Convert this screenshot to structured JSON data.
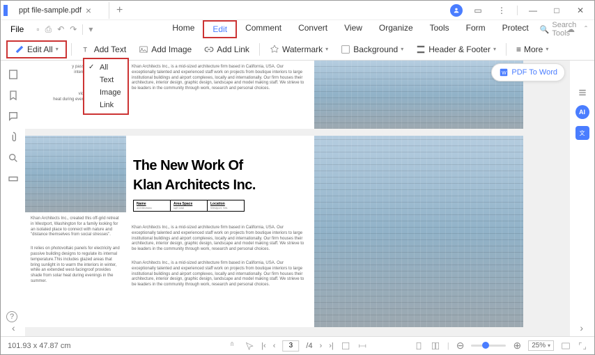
{
  "tab": {
    "title": "ppt file-sample.pdf"
  },
  "menu": {
    "file": "File",
    "tabs": [
      "Home",
      "Edit",
      "Comment",
      "Convert",
      "View",
      "Organize",
      "Tools",
      "Form",
      "Protect"
    ],
    "active": "Edit",
    "search": "Search Tools"
  },
  "toolbar": {
    "edit_all": "Edit All",
    "add_text": "Add Text",
    "add_image": "Add Image",
    "add_link": "Add Link",
    "watermark": "Watermark",
    "background": "Background",
    "header_footer": "Header & Footer",
    "more": "More"
  },
  "dropdown": {
    "items": [
      "All",
      "Text",
      "Image",
      "Link"
    ],
    "checked": "All"
  },
  "float_btn": "PDF To Word",
  "page": {
    "heading1": "The New Work Of",
    "heading2": "Klan Architects Inc.",
    "table": [
      {
        "lbl": "Name",
        "val": "architectsinc"
      },
      {
        "lbl": "Area Space",
        "val": "sqft total"
      },
      {
        "lbl": "Location",
        "val": "Westport, WA"
      }
    ],
    "left_txt_top": "y passive building designs\ninternal temperature.This\nd areas that bring\nvarm the interiors in\nin extended west-\nvides shade from solar\nheat during evenings in the summer.",
    "body1": "Khan Architects Inc., is a mid-sized architecture firm based in California, USA. Our exceptionally talented and experienced staff work on projects from boutique interiors to large institutional buildings and airport complexes, locally and internationally. Our firm houses their architecture, interior design, graphic design, landscape and model making staff. We strieve to be leaders in the community through work, research and personal choices.",
    "left_txt2a": "Khan Architects Inc., created this off-grid retreat in Westport, Washington for a family looking for an isolated place to connect with nature and \"distance themselves from social stresses\".",
    "left_txt2b": "It relies on photovoltaic panels for electricity and passive building designs to regulate its internal temperature.This includes glazed areas that bring sunlight in to warm the interiors in winter, while an extended west-facingroof provides shade from solar heat during evenings in the summer."
  },
  "status": {
    "dims": "101.93 x 47.87 cm",
    "page_current": "3",
    "page_total": "/4",
    "zoom": "25%"
  }
}
